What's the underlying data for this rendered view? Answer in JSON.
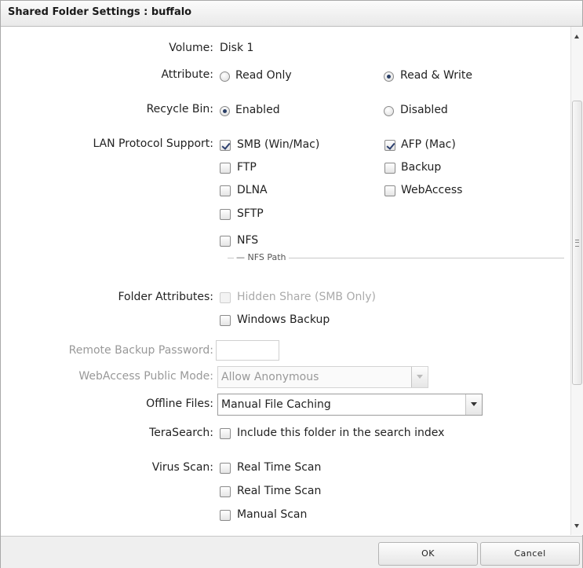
{
  "dialog": {
    "title": "Shared Folder Settings : buffalo"
  },
  "volume": {
    "label": "Volume:",
    "value": "Disk 1"
  },
  "attribute": {
    "label": "Attribute:",
    "read_only": "Read Only",
    "read_write": "Read & Write",
    "selected": "Read & Write"
  },
  "recycle_bin": {
    "label": "Recycle Bin:",
    "enabled": "Enabled",
    "disabled": "Disabled",
    "selected": "Enabled"
  },
  "lan_protocol": {
    "label": "LAN Protocol Support:",
    "smb": "SMB (Win/Mac)",
    "afp": "AFP (Mac)",
    "ftp": "FTP",
    "backup": "Backup",
    "dlna": "DLNA",
    "webaccess": "WebAccess",
    "sftp": "SFTP",
    "nfs": "NFS",
    "checked": [
      "SMB (Win/Mac)",
      "AFP (Mac)"
    ]
  },
  "nfs_path": {
    "legend": "NFS Path"
  },
  "folder_attributes": {
    "label": "Folder Attributes:",
    "hidden_share": "Hidden Share (SMB Only)",
    "windows_backup": "Windows Backup"
  },
  "remote_backup": {
    "label": "Remote Backup Password:",
    "value": ""
  },
  "webaccess_mode": {
    "label": "WebAccess Public Mode:",
    "value": "Allow Anonymous"
  },
  "offline_files": {
    "label": "Offline Files:",
    "value": "Manual File Caching"
  },
  "terasearch": {
    "label": "TeraSearch:",
    "option": "Include this folder in the search index"
  },
  "virus_scan": {
    "label": "Virus Scan:",
    "option1": "Real Time Scan",
    "option2": "Real Time Scan",
    "option3": "Manual Scan"
  },
  "buttons": {
    "ok": "OK",
    "cancel": "Cancel"
  }
}
